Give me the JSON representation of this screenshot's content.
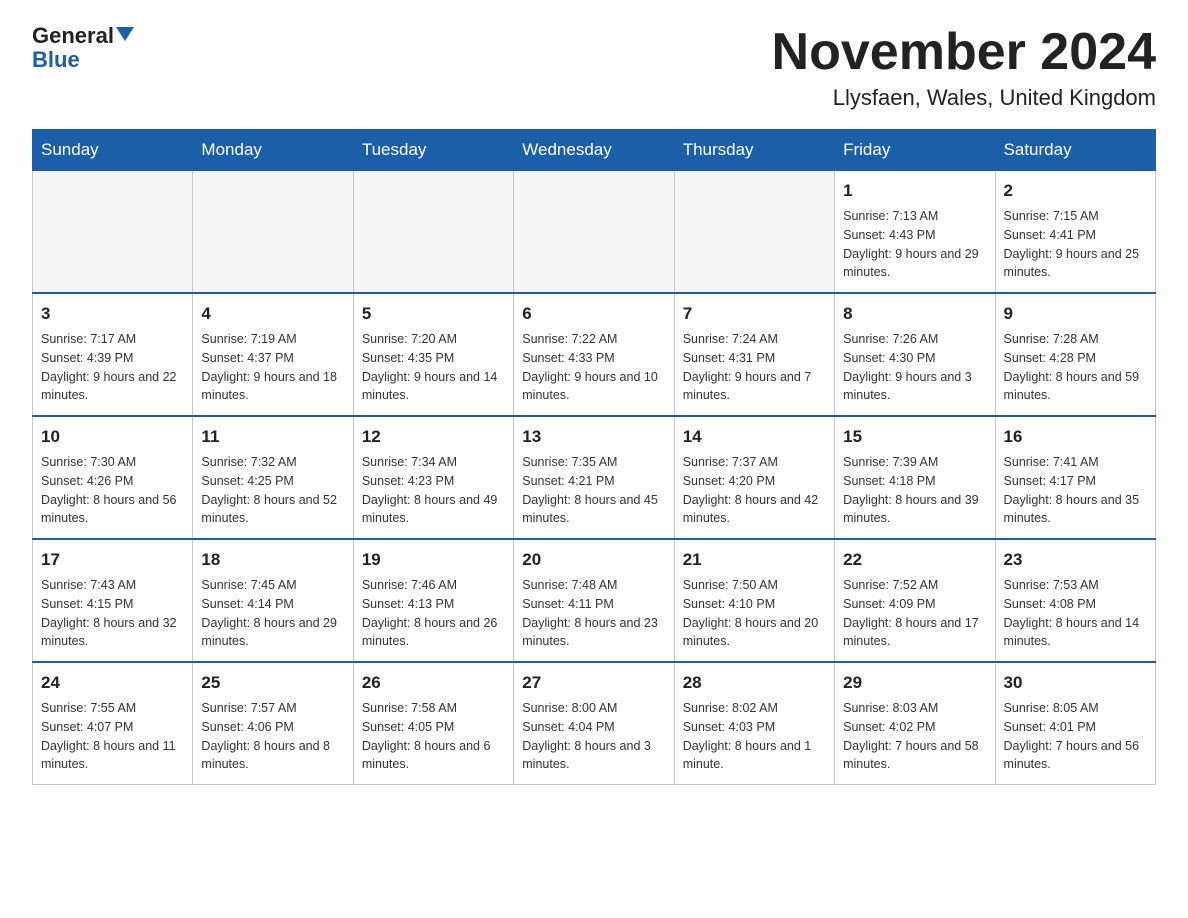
{
  "logo": {
    "text_general": "General",
    "text_blue": "Blue",
    "tagline": ""
  },
  "title": "November 2024",
  "subtitle": "Llysfaen, Wales, United Kingdom",
  "weekdays": [
    "Sunday",
    "Monday",
    "Tuesday",
    "Wednesday",
    "Thursday",
    "Friday",
    "Saturday"
  ],
  "weeks": [
    [
      {
        "day": "",
        "info": ""
      },
      {
        "day": "",
        "info": ""
      },
      {
        "day": "",
        "info": ""
      },
      {
        "day": "",
        "info": ""
      },
      {
        "day": "",
        "info": ""
      },
      {
        "day": "1",
        "info": "Sunrise: 7:13 AM\nSunset: 4:43 PM\nDaylight: 9 hours and 29 minutes."
      },
      {
        "day": "2",
        "info": "Sunrise: 7:15 AM\nSunset: 4:41 PM\nDaylight: 9 hours and 25 minutes."
      }
    ],
    [
      {
        "day": "3",
        "info": "Sunrise: 7:17 AM\nSunset: 4:39 PM\nDaylight: 9 hours and 22 minutes."
      },
      {
        "day": "4",
        "info": "Sunrise: 7:19 AM\nSunset: 4:37 PM\nDaylight: 9 hours and 18 minutes."
      },
      {
        "day": "5",
        "info": "Sunrise: 7:20 AM\nSunset: 4:35 PM\nDaylight: 9 hours and 14 minutes."
      },
      {
        "day": "6",
        "info": "Sunrise: 7:22 AM\nSunset: 4:33 PM\nDaylight: 9 hours and 10 minutes."
      },
      {
        "day": "7",
        "info": "Sunrise: 7:24 AM\nSunset: 4:31 PM\nDaylight: 9 hours and 7 minutes."
      },
      {
        "day": "8",
        "info": "Sunrise: 7:26 AM\nSunset: 4:30 PM\nDaylight: 9 hours and 3 minutes."
      },
      {
        "day": "9",
        "info": "Sunrise: 7:28 AM\nSunset: 4:28 PM\nDaylight: 8 hours and 59 minutes."
      }
    ],
    [
      {
        "day": "10",
        "info": "Sunrise: 7:30 AM\nSunset: 4:26 PM\nDaylight: 8 hours and 56 minutes."
      },
      {
        "day": "11",
        "info": "Sunrise: 7:32 AM\nSunset: 4:25 PM\nDaylight: 8 hours and 52 minutes."
      },
      {
        "day": "12",
        "info": "Sunrise: 7:34 AM\nSunset: 4:23 PM\nDaylight: 8 hours and 49 minutes."
      },
      {
        "day": "13",
        "info": "Sunrise: 7:35 AM\nSunset: 4:21 PM\nDaylight: 8 hours and 45 minutes."
      },
      {
        "day": "14",
        "info": "Sunrise: 7:37 AM\nSunset: 4:20 PM\nDaylight: 8 hours and 42 minutes."
      },
      {
        "day": "15",
        "info": "Sunrise: 7:39 AM\nSunset: 4:18 PM\nDaylight: 8 hours and 39 minutes."
      },
      {
        "day": "16",
        "info": "Sunrise: 7:41 AM\nSunset: 4:17 PM\nDaylight: 8 hours and 35 minutes."
      }
    ],
    [
      {
        "day": "17",
        "info": "Sunrise: 7:43 AM\nSunset: 4:15 PM\nDaylight: 8 hours and 32 minutes."
      },
      {
        "day": "18",
        "info": "Sunrise: 7:45 AM\nSunset: 4:14 PM\nDaylight: 8 hours and 29 minutes."
      },
      {
        "day": "19",
        "info": "Sunrise: 7:46 AM\nSunset: 4:13 PM\nDaylight: 8 hours and 26 minutes."
      },
      {
        "day": "20",
        "info": "Sunrise: 7:48 AM\nSunset: 4:11 PM\nDaylight: 8 hours and 23 minutes."
      },
      {
        "day": "21",
        "info": "Sunrise: 7:50 AM\nSunset: 4:10 PM\nDaylight: 8 hours and 20 minutes."
      },
      {
        "day": "22",
        "info": "Sunrise: 7:52 AM\nSunset: 4:09 PM\nDaylight: 8 hours and 17 minutes."
      },
      {
        "day": "23",
        "info": "Sunrise: 7:53 AM\nSunset: 4:08 PM\nDaylight: 8 hours and 14 minutes."
      }
    ],
    [
      {
        "day": "24",
        "info": "Sunrise: 7:55 AM\nSunset: 4:07 PM\nDaylight: 8 hours and 11 minutes."
      },
      {
        "day": "25",
        "info": "Sunrise: 7:57 AM\nSunset: 4:06 PM\nDaylight: 8 hours and 8 minutes."
      },
      {
        "day": "26",
        "info": "Sunrise: 7:58 AM\nSunset: 4:05 PM\nDaylight: 8 hours and 6 minutes."
      },
      {
        "day": "27",
        "info": "Sunrise: 8:00 AM\nSunset: 4:04 PM\nDaylight: 8 hours and 3 minutes."
      },
      {
        "day": "28",
        "info": "Sunrise: 8:02 AM\nSunset: 4:03 PM\nDaylight: 8 hours and 1 minute."
      },
      {
        "day": "29",
        "info": "Sunrise: 8:03 AM\nSunset: 4:02 PM\nDaylight: 7 hours and 58 minutes."
      },
      {
        "day": "30",
        "info": "Sunrise: 8:05 AM\nSunset: 4:01 PM\nDaylight: 7 hours and 56 minutes."
      }
    ]
  ]
}
